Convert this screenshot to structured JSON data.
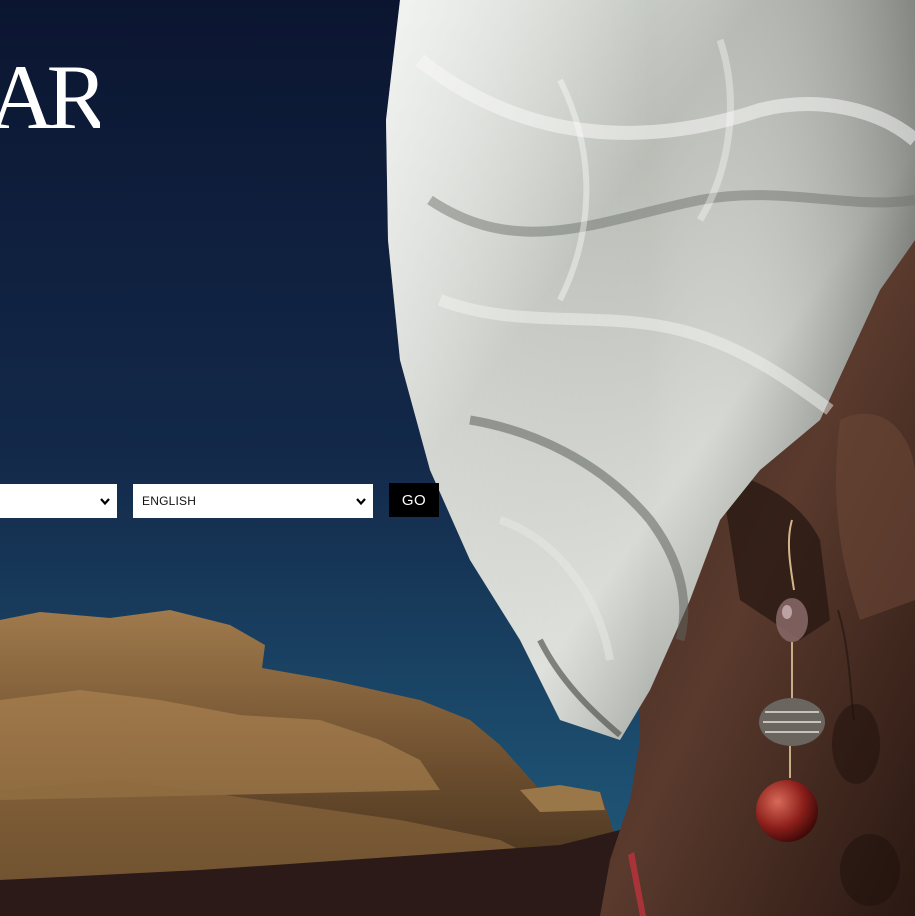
{
  "brand": {
    "name": "ZARA"
  },
  "selector": {
    "country_value": "",
    "language_value": "ENGLISH",
    "go_label": "GO"
  },
  "colors": {
    "sky_top": "#0b1530",
    "sky_bottom": "#1a4d6e",
    "button_bg": "#000000",
    "select_bg": "#ffffff"
  }
}
